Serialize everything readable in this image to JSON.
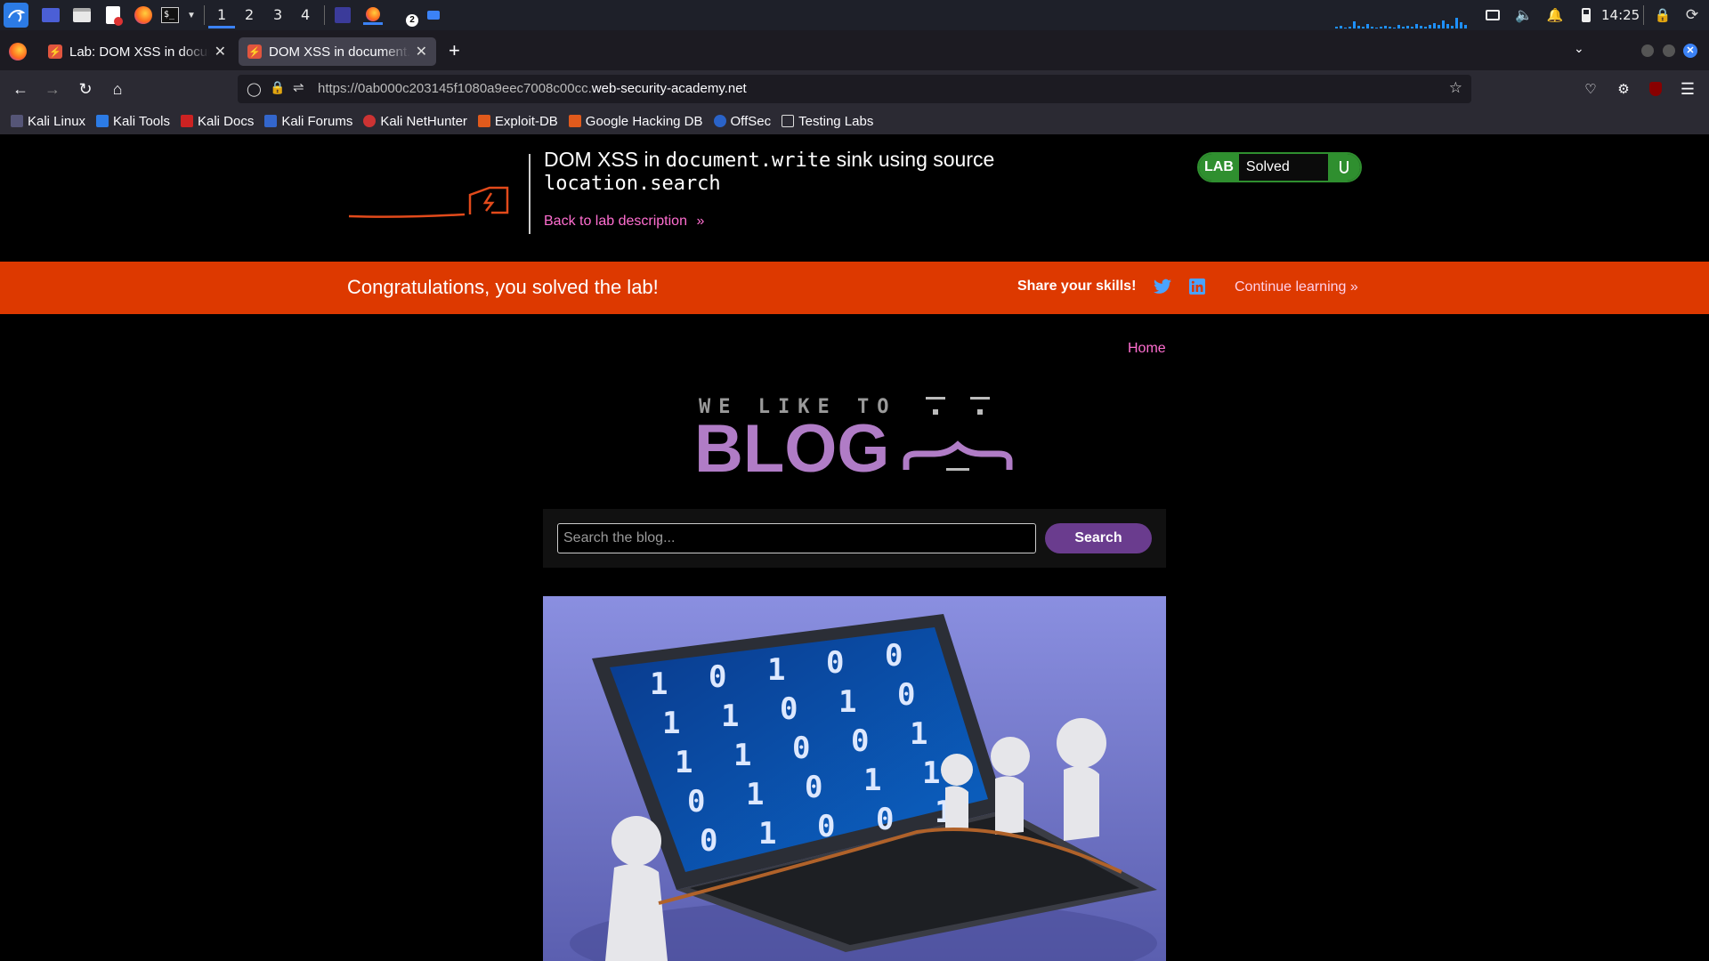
{
  "taskbar": {
    "workspaces": [
      "1",
      "2",
      "3",
      "4"
    ],
    "notification_count": "2",
    "clock": "14:25"
  },
  "browser": {
    "tabs": [
      {
        "title": "Lab: DOM XSS in document.write",
        "active": false
      },
      {
        "title": "DOM XSS in document.write",
        "active": true
      }
    ],
    "url_prefix": "https://0ab000c203145f1080a9eec7008c00cc.",
    "url_domain": "web-security-academy.net",
    "bookmarks": [
      "Kali Linux",
      "Kali Tools",
      "Kali Docs",
      "Kali Forums",
      "Kali NetHunter",
      "Exploit-DB",
      "Google Hacking DB",
      "OffSec",
      "Testing Labs"
    ]
  },
  "lab_header": {
    "title_part1": "DOM XSS in ",
    "title_code1": "document.write",
    "title_part2": " sink using source ",
    "title_code2": "location.search",
    "back_link": "Back to lab description",
    "status_badge": "LAB",
    "status_text": "Solved"
  },
  "banner": {
    "message": "Congratulations, you solved the lab!",
    "share_label": "Share your skills!",
    "continue_link": "Continue learning"
  },
  "blog": {
    "nav_home": "Home",
    "logo_tagline": "WE LIKE TO",
    "logo_word": "BLOG",
    "search_placeholder": "Search the blog...",
    "search_button": "Search",
    "image_digits": [
      "1",
      "0",
      "1",
      "0",
      "0",
      "1",
      "1",
      "0",
      "1",
      "0",
      "1",
      "1",
      "0",
      "0",
      "1",
      "0",
      "1",
      "0",
      "1",
      "1",
      "0",
      "1",
      "0",
      "0",
      "1"
    ]
  },
  "colors": {
    "accent_pink": "#ff6ed0",
    "banner_orange": "#dd3900",
    "solved_green": "#2f8f2f",
    "search_purple": "#6a3c8e",
    "blog_purple": "#b07cc6"
  }
}
